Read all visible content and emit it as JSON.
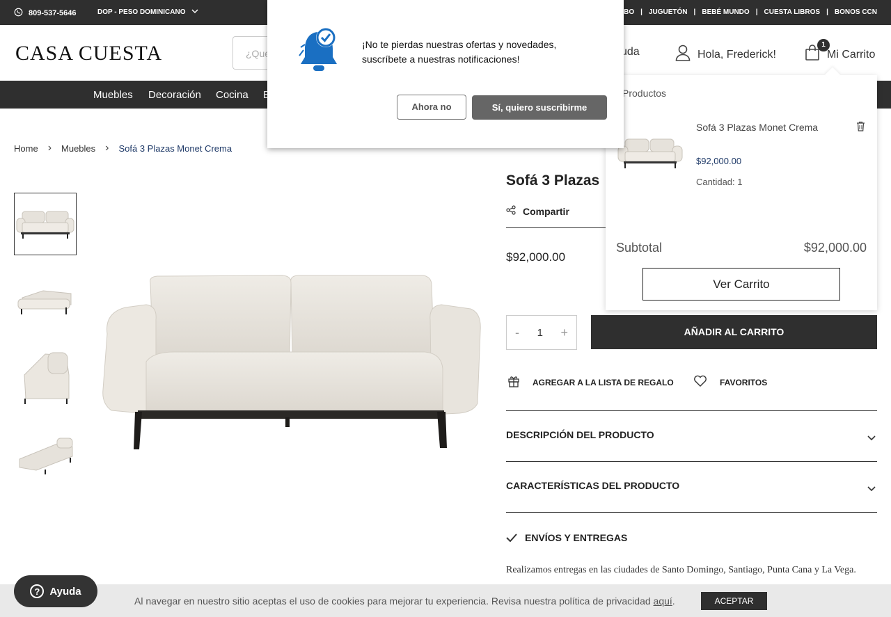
{
  "topbar": {
    "phone": "809-537-5646",
    "currency": "DOP - PESO DOMINICANO",
    "links": [
      "MBO",
      "JUGUETÓN",
      "BEBÉ MUNDO",
      "CUESTA LIBROS",
      "BONOS CCN"
    ]
  },
  "header": {
    "logo": "CASA CUESTA",
    "search_placeholder": "¿Qué",
    "help": "yuda",
    "user_greeting": "Hola, Frederick!",
    "cart_label": "Mi Carrito",
    "cart_count": "1"
  },
  "nav": {
    "items": [
      "Muebles",
      "Decoración",
      "Cocina",
      "E"
    ]
  },
  "breadcrumb": {
    "home": "Home",
    "category": "Muebles",
    "current": "Sofá 3 Plazas Monet Crema"
  },
  "product": {
    "title": "Sofá 3 Plazas",
    "share": "Compartir",
    "price": "$92,000.00",
    "quantity": "1",
    "qty_minus": "-",
    "qty_plus": "+",
    "add_to_cart": "AÑADIR AL CARRITO",
    "gift_list": "AGREGAR A LA LISTA DE REGALO",
    "favorites": "FAVORITOS",
    "sections": {
      "description": "DESCRIPCIÓN DEL PRODUCTO",
      "features": "CARACTERÍSTICAS DEL PRODUCTO",
      "shipping": "ENVÍOS Y ENTREGAS"
    },
    "shipping_text": "Realizamos entregas en las ciudades de Santo Domingo, Santiago, Punta Cana y La Vega."
  },
  "popup": {
    "message": "¡No te pierdas nuestras ofertas y novedades, suscríbete a nuestras notificaciones!",
    "decline": "Ahora no",
    "accept": "Sí, quiero suscribirme"
  },
  "minicart": {
    "heading": "Productos",
    "item_name": "Sofá 3 Plazas Monet Crema",
    "item_price": "$92,000.00",
    "item_qty": "Cantidad: 1",
    "subtotal_label": "Subtotal",
    "subtotal_value": "$92,000.00",
    "view_cart": "Ver Carrito"
  },
  "cookie": {
    "text": "Al navegar en nuestro sitio aceptas el uso de cookies para mejorar tu experiencia. Revisa nuestra política de privacidad ",
    "link": "aquí",
    "period": ".",
    "accept": "ACEPTAR"
  },
  "help_bubble": {
    "icon": "?",
    "label": "Ayuda"
  },
  "colors": {
    "dark": "#2f2f2f",
    "link_blue": "#1f3a68",
    "bell_blue": "#1a6fc2"
  }
}
